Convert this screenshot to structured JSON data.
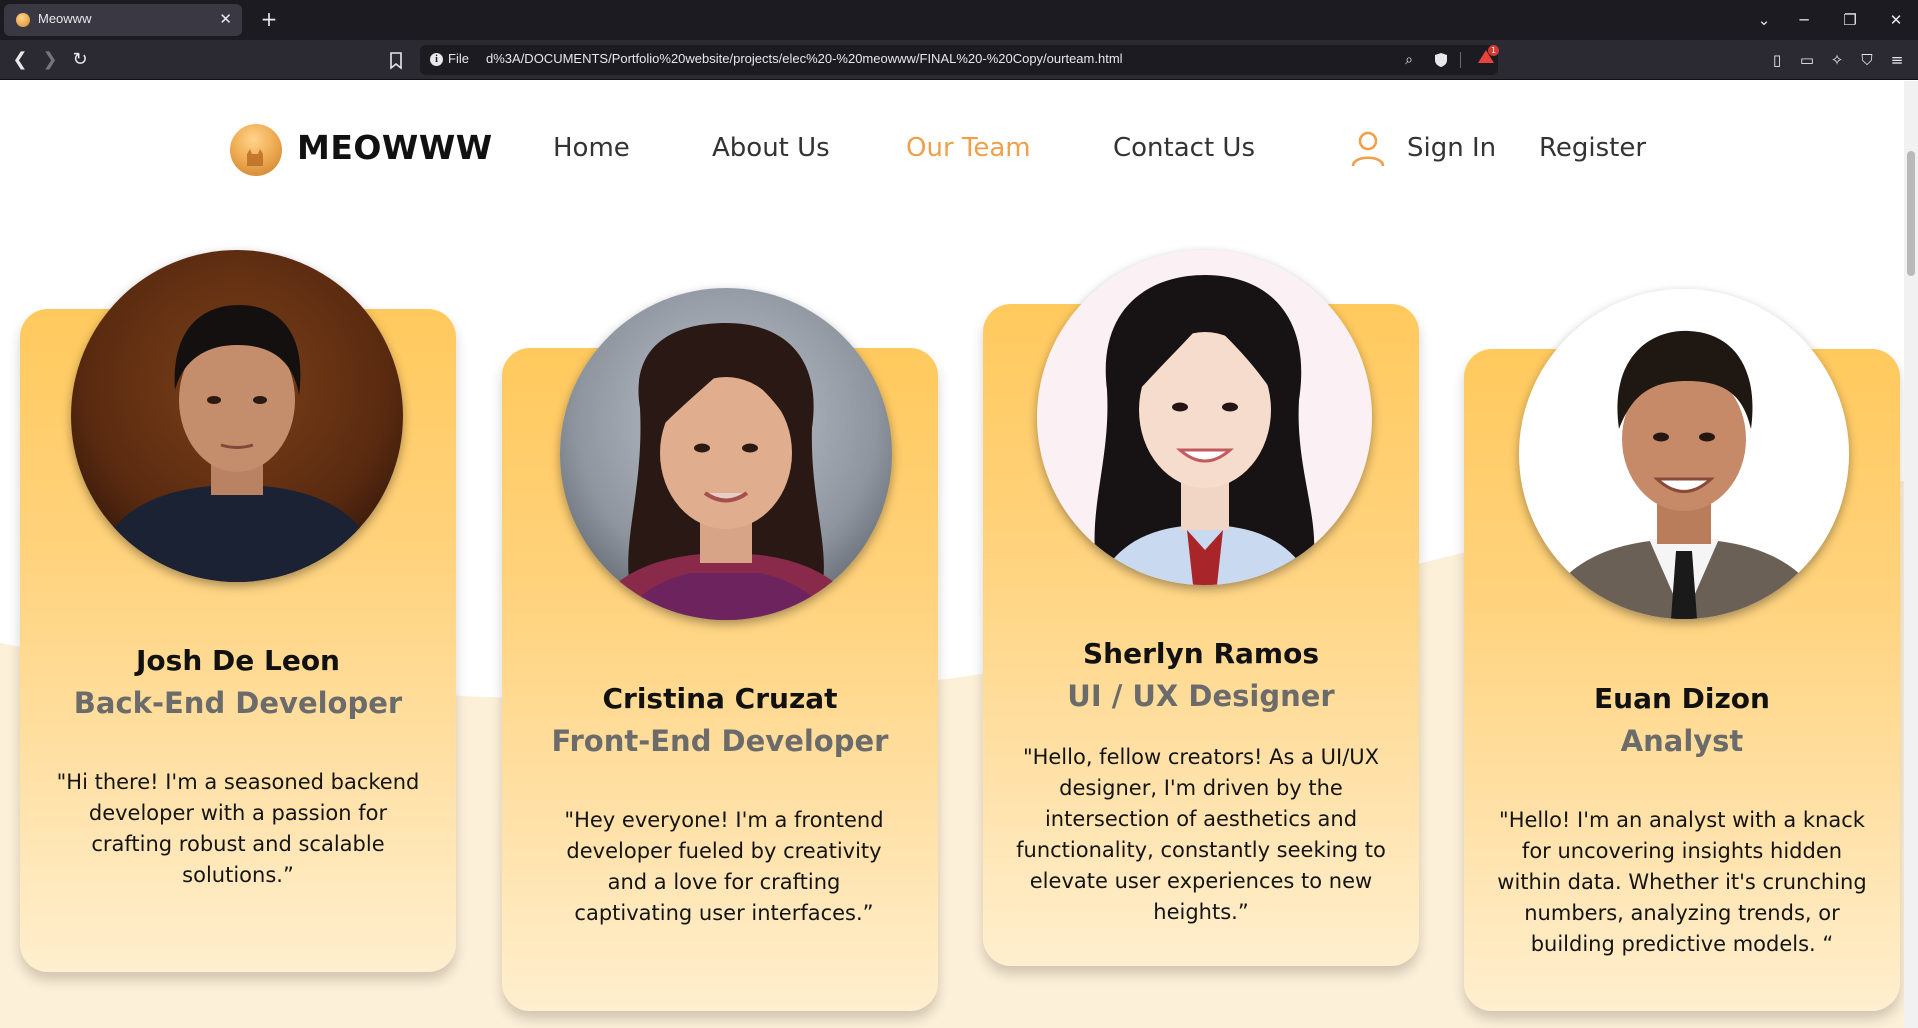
{
  "browser": {
    "tab_title": "Meowww",
    "tab_close": "✕",
    "new_tab": "+",
    "url_scheme": "File",
    "url": "d%3A/DOCUMENTS/Portfolio%20website/projects/elec%20-%20meowww/FINAL%20-%20Copy/ourteam.html",
    "badge_count": "1"
  },
  "header": {
    "logo_text": "MEOWWW",
    "nav": [
      {
        "label": "Home"
      },
      {
        "label": "About Us"
      },
      {
        "label": "Our Team"
      },
      {
        "label": "Contact Us"
      }
    ],
    "sign_in": "Sign In",
    "register": "Register",
    "active_color": "#f0a04b"
  },
  "team": [
    {
      "name": "Josh De Leon",
      "role": "Back-End Developer",
      "quote": "\"Hi there! I'm a seasoned backend developer with a passion for crafting robust and scalable solutions.”"
    },
    {
      "name": "Cristina Cruzat",
      "role": "Front-End Developer",
      "quote": "\"Hey everyone! I'm a frontend developer fueled by creativity and a love for crafting captivating user interfaces.”"
    },
    {
      "name": "Sherlyn Ramos",
      "role": "UI / UX Designer",
      "quote": "\"Hello, fellow creators! As a UI/UX designer, I'm driven by the intersection of aesthetics and functionality, constantly seeking to elevate user experiences to new heights.”"
    },
    {
      "name": "Euan Dizon",
      "role": "Analyst",
      "quote": "\"Hello! I'm an analyst with a knack for uncovering insights hidden within data. Whether it's crunching numbers, analyzing trends, or building predictive models. “"
    }
  ],
  "colors": {
    "card_top": "#ffc95d",
    "card_bottom": "#ffefcf",
    "wave": "#fdf0d8"
  }
}
